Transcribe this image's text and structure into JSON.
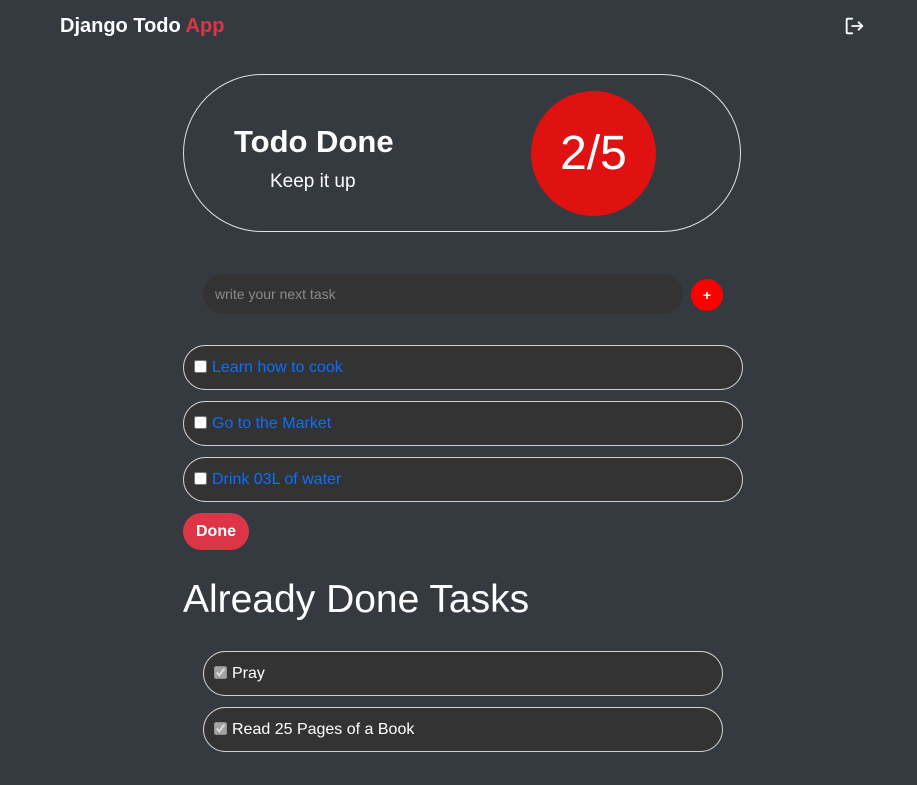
{
  "navbar": {
    "brand_main": "Django Todo",
    "brand_accent": "App",
    "logout_icon": "logout-icon"
  },
  "summary": {
    "title": "Todo Done",
    "subtitle": "Keep it up",
    "counter": "2/5"
  },
  "new_task": {
    "placeholder": "write your next task",
    "value": "",
    "add_label": "+"
  },
  "pending_tasks": [
    {
      "label": "Learn how to cook",
      "checked": false
    },
    {
      "label": "Go to the Market",
      "checked": false
    },
    {
      "label": "Drink 03L of water",
      "checked": false
    }
  ],
  "done_button_label": "Done",
  "done_section": {
    "title": "Already Done Tasks",
    "tasks": [
      {
        "label": "Pray",
        "checked": true
      },
      {
        "label": "Read 25 Pages of a Book",
        "checked": true
      }
    ]
  },
  "colors": {
    "background": "#343a40",
    "accent": "#dc3545",
    "counter_bg": "#e01111",
    "add_button": "#ff0000",
    "link": "#0d6efd",
    "task_bg": "#333333"
  }
}
